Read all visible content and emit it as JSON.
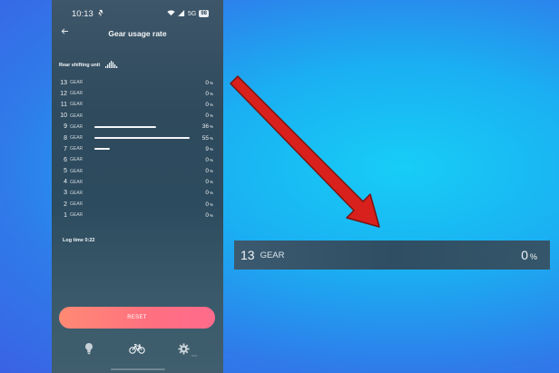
{
  "status": {
    "time": "10:13",
    "network": "5G",
    "battery": "98"
  },
  "header": {
    "title": "Gear usage rate"
  },
  "unit_label": "Rear shifting unit",
  "gear_word": "GEAR",
  "percent_symbol": "%",
  "gears": [
    {
      "num": "13",
      "pct": "0",
      "share": 0
    },
    {
      "num": "12",
      "pct": "0",
      "share": 0
    },
    {
      "num": "11",
      "pct": "0",
      "share": 0
    },
    {
      "num": "10",
      "pct": "0",
      "share": 0
    },
    {
      "num": "9",
      "pct": "36",
      "share": 36
    },
    {
      "num": "8",
      "pct": "55",
      "share": 55
    },
    {
      "num": "7",
      "pct": "9",
      "share": 9
    },
    {
      "num": "6",
      "pct": "0",
      "share": 0
    },
    {
      "num": "5",
      "pct": "0",
      "share": 0
    },
    {
      "num": "4",
      "pct": "0",
      "share": 0
    },
    {
      "num": "3",
      "pct": "0",
      "share": 0
    },
    {
      "num": "2",
      "pct": "0",
      "share": 0
    },
    {
      "num": "1",
      "pct": "0",
      "share": 0
    }
  ],
  "log_time": "Log time 0:22",
  "reset_label": "RESET",
  "zoom": {
    "num": "13",
    "label": "GEAR",
    "pct": "0",
    "symbol": "%"
  },
  "colors": {
    "reset_start": "#ff8a74",
    "reset_end": "#ff6b8c",
    "arrow": "#d8211c",
    "arrow_outline": "#7a1410"
  },
  "icons": [
    "back-arrow-icon",
    "bell-off-icon",
    "wifi-icon",
    "signal-icon",
    "battery-icon",
    "bar-chart-icon",
    "lightbulb-icon",
    "bicycle-icon",
    "gear-icon",
    "more-dots-icon"
  ]
}
